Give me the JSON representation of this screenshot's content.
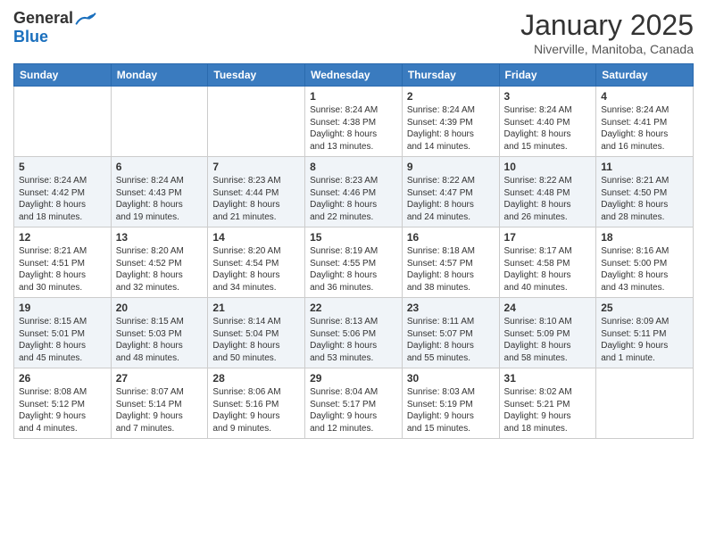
{
  "logo": {
    "general": "General",
    "blue": "Blue"
  },
  "title": "January 2025",
  "location": "Niverville, Manitoba, Canada",
  "weekdays": [
    "Sunday",
    "Monday",
    "Tuesday",
    "Wednesday",
    "Thursday",
    "Friday",
    "Saturday"
  ],
  "weeks": [
    [
      {
        "day": "",
        "info": ""
      },
      {
        "day": "",
        "info": ""
      },
      {
        "day": "",
        "info": ""
      },
      {
        "day": "1",
        "info": "Sunrise: 8:24 AM\nSunset: 4:38 PM\nDaylight: 8 hours\nand 13 minutes."
      },
      {
        "day": "2",
        "info": "Sunrise: 8:24 AM\nSunset: 4:39 PM\nDaylight: 8 hours\nand 14 minutes."
      },
      {
        "day": "3",
        "info": "Sunrise: 8:24 AM\nSunset: 4:40 PM\nDaylight: 8 hours\nand 15 minutes."
      },
      {
        "day": "4",
        "info": "Sunrise: 8:24 AM\nSunset: 4:41 PM\nDaylight: 8 hours\nand 16 minutes."
      }
    ],
    [
      {
        "day": "5",
        "info": "Sunrise: 8:24 AM\nSunset: 4:42 PM\nDaylight: 8 hours\nand 18 minutes."
      },
      {
        "day": "6",
        "info": "Sunrise: 8:24 AM\nSunset: 4:43 PM\nDaylight: 8 hours\nand 19 minutes."
      },
      {
        "day": "7",
        "info": "Sunrise: 8:23 AM\nSunset: 4:44 PM\nDaylight: 8 hours\nand 21 minutes."
      },
      {
        "day": "8",
        "info": "Sunrise: 8:23 AM\nSunset: 4:46 PM\nDaylight: 8 hours\nand 22 minutes."
      },
      {
        "day": "9",
        "info": "Sunrise: 8:22 AM\nSunset: 4:47 PM\nDaylight: 8 hours\nand 24 minutes."
      },
      {
        "day": "10",
        "info": "Sunrise: 8:22 AM\nSunset: 4:48 PM\nDaylight: 8 hours\nand 26 minutes."
      },
      {
        "day": "11",
        "info": "Sunrise: 8:21 AM\nSunset: 4:50 PM\nDaylight: 8 hours\nand 28 minutes."
      }
    ],
    [
      {
        "day": "12",
        "info": "Sunrise: 8:21 AM\nSunset: 4:51 PM\nDaylight: 8 hours\nand 30 minutes."
      },
      {
        "day": "13",
        "info": "Sunrise: 8:20 AM\nSunset: 4:52 PM\nDaylight: 8 hours\nand 32 minutes."
      },
      {
        "day": "14",
        "info": "Sunrise: 8:20 AM\nSunset: 4:54 PM\nDaylight: 8 hours\nand 34 minutes."
      },
      {
        "day": "15",
        "info": "Sunrise: 8:19 AM\nSunset: 4:55 PM\nDaylight: 8 hours\nand 36 minutes."
      },
      {
        "day": "16",
        "info": "Sunrise: 8:18 AM\nSunset: 4:57 PM\nDaylight: 8 hours\nand 38 minutes."
      },
      {
        "day": "17",
        "info": "Sunrise: 8:17 AM\nSunset: 4:58 PM\nDaylight: 8 hours\nand 40 minutes."
      },
      {
        "day": "18",
        "info": "Sunrise: 8:16 AM\nSunset: 5:00 PM\nDaylight: 8 hours\nand 43 minutes."
      }
    ],
    [
      {
        "day": "19",
        "info": "Sunrise: 8:15 AM\nSunset: 5:01 PM\nDaylight: 8 hours\nand 45 minutes."
      },
      {
        "day": "20",
        "info": "Sunrise: 8:15 AM\nSunset: 5:03 PM\nDaylight: 8 hours\nand 48 minutes."
      },
      {
        "day": "21",
        "info": "Sunrise: 8:14 AM\nSunset: 5:04 PM\nDaylight: 8 hours\nand 50 minutes."
      },
      {
        "day": "22",
        "info": "Sunrise: 8:13 AM\nSunset: 5:06 PM\nDaylight: 8 hours\nand 53 minutes."
      },
      {
        "day": "23",
        "info": "Sunrise: 8:11 AM\nSunset: 5:07 PM\nDaylight: 8 hours\nand 55 minutes."
      },
      {
        "day": "24",
        "info": "Sunrise: 8:10 AM\nSunset: 5:09 PM\nDaylight: 8 hours\nand 58 minutes."
      },
      {
        "day": "25",
        "info": "Sunrise: 8:09 AM\nSunset: 5:11 PM\nDaylight: 9 hours\nand 1 minute."
      }
    ],
    [
      {
        "day": "26",
        "info": "Sunrise: 8:08 AM\nSunset: 5:12 PM\nDaylight: 9 hours\nand 4 minutes."
      },
      {
        "day": "27",
        "info": "Sunrise: 8:07 AM\nSunset: 5:14 PM\nDaylight: 9 hours\nand 7 minutes."
      },
      {
        "day": "28",
        "info": "Sunrise: 8:06 AM\nSunset: 5:16 PM\nDaylight: 9 hours\nand 9 minutes."
      },
      {
        "day": "29",
        "info": "Sunrise: 8:04 AM\nSunset: 5:17 PM\nDaylight: 9 hours\nand 12 minutes."
      },
      {
        "day": "30",
        "info": "Sunrise: 8:03 AM\nSunset: 5:19 PM\nDaylight: 9 hours\nand 15 minutes."
      },
      {
        "day": "31",
        "info": "Sunrise: 8:02 AM\nSunset: 5:21 PM\nDaylight: 9 hours\nand 18 minutes."
      },
      {
        "day": "",
        "info": ""
      }
    ]
  ]
}
